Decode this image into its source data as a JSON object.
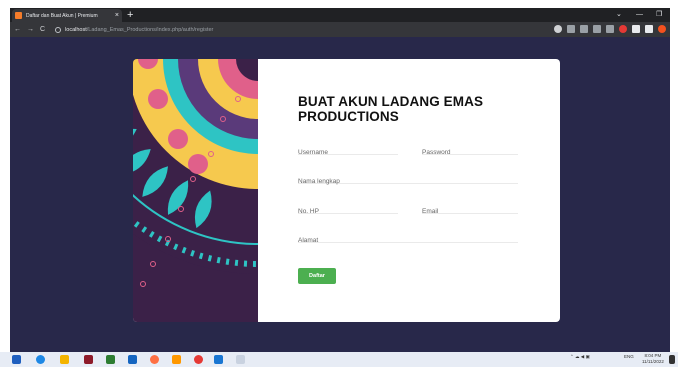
{
  "browser": {
    "tab_title": "Daftar dan Buat Akun | Premium",
    "tab_close": "×",
    "new_tab": "+",
    "url_host": "localhost",
    "url_path": "/Ladang_Emas_Productions/index.php/auth/register",
    "window_controls": {
      "chevron": "⌄",
      "minimize": "—",
      "maximize": "❐"
    },
    "nav": {
      "back": "←",
      "forward": "→",
      "reload": "C"
    }
  },
  "form": {
    "title": "BUAT AKUN LADANG EMAS PRODUCTIONS",
    "username_placeholder": "Username",
    "password_placeholder": "Password",
    "fullname_placeholder": "Nama lengkap",
    "phone_placeholder": "No. HP",
    "email_placeholder": "Email",
    "address_placeholder": "Alamat",
    "submit_label": "Daftar"
  },
  "taskbar": {
    "language": "ENG",
    "time": "8:04 PM",
    "date": "11/11/2022"
  },
  "colors": {
    "page_bg": "#28284a",
    "art_bg": "#3b2148",
    "button": "#4caf50"
  }
}
